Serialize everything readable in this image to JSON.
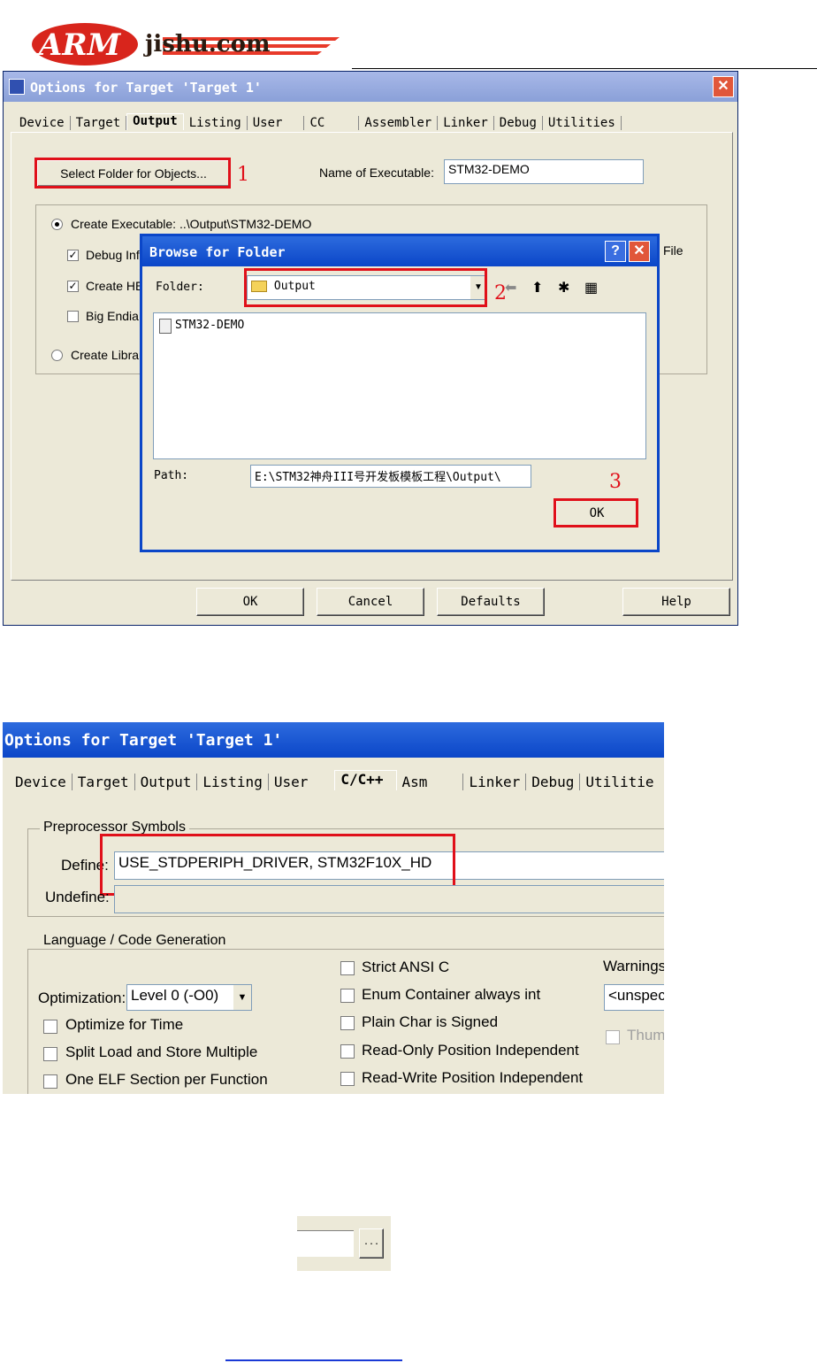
{
  "logo": {
    "text_left": "ARM",
    "text_right": "jishu.com"
  },
  "dialog1": {
    "title": "Options for Target 'Target 1'",
    "tabs": [
      "Device",
      "Target",
      "Output",
      "Listing",
      "User",
      "CC",
      "Assembler",
      "Linker",
      "Debug",
      "Utilities"
    ],
    "active_tab": "Output",
    "select_folder_label": "Select Folder for Objects...",
    "name_exec_label": "Name of Executable:",
    "name_exec_value": "STM32-DEMO",
    "create_exec_label": "Create Executable:  ..\\Output\\STM32-DEMO",
    "debug_info_label": "Debug Inf",
    "create_hex_label": "Create HE",
    "big_endian_label": "Big Endia",
    "create_lib_label": "Create Librar",
    "file_label": "File",
    "ok_label": "OK",
    "cancel_label": "Cancel",
    "defaults_label": "Defaults",
    "help_label": "Help",
    "annot_1": "1"
  },
  "browse": {
    "title": "Browse for Folder",
    "folder_label": "Folder:",
    "folder_value": "Output",
    "file_item": "STM32-DEMO",
    "path_label": "Path:",
    "path_value": "E:\\STM32神舟III号开发板模板工程\\Output\\",
    "ok_label": "OK",
    "help_glyph": "?",
    "close_glyph": "✕",
    "annot_2": "2",
    "annot_3": "3"
  },
  "dialog2": {
    "title": "Options for Target 'Target 1'",
    "tabs": [
      "Device",
      "Target",
      "Output",
      "Listing",
      "User",
      "C/C++",
      "Asm",
      "Linker",
      "Debug",
      "Utilitie"
    ],
    "active_tab": "C/C++",
    "preproc_group": "Preprocessor Symbols",
    "define_label": "Define:",
    "define_value": "USE_STDPERIPH_DRIVER, STM32F10X_HD",
    "undefine_label": "Undefine:",
    "lang_group": "Language / Code Generation",
    "optimization_label": "Optimization:",
    "optimization_value": "Level 0 (-O0)",
    "opt_time": "Optimize for Time",
    "split_load": "Split Load and Store Multiple",
    "one_elf": "One ELF Section per Function",
    "strict_ansi": "Strict ANSI C",
    "enum_container": "Enum Container always int",
    "plain_char": "Plain Char is Signed",
    "ro_pos": "Read-Only Position Independent",
    "rw_pos": "Read-Write Position Independent",
    "warnings_label": "Warnings:",
    "warnings_value": "<unspec",
    "thumb_label": "Thum"
  },
  "small_button": {
    "glyph": "..."
  }
}
